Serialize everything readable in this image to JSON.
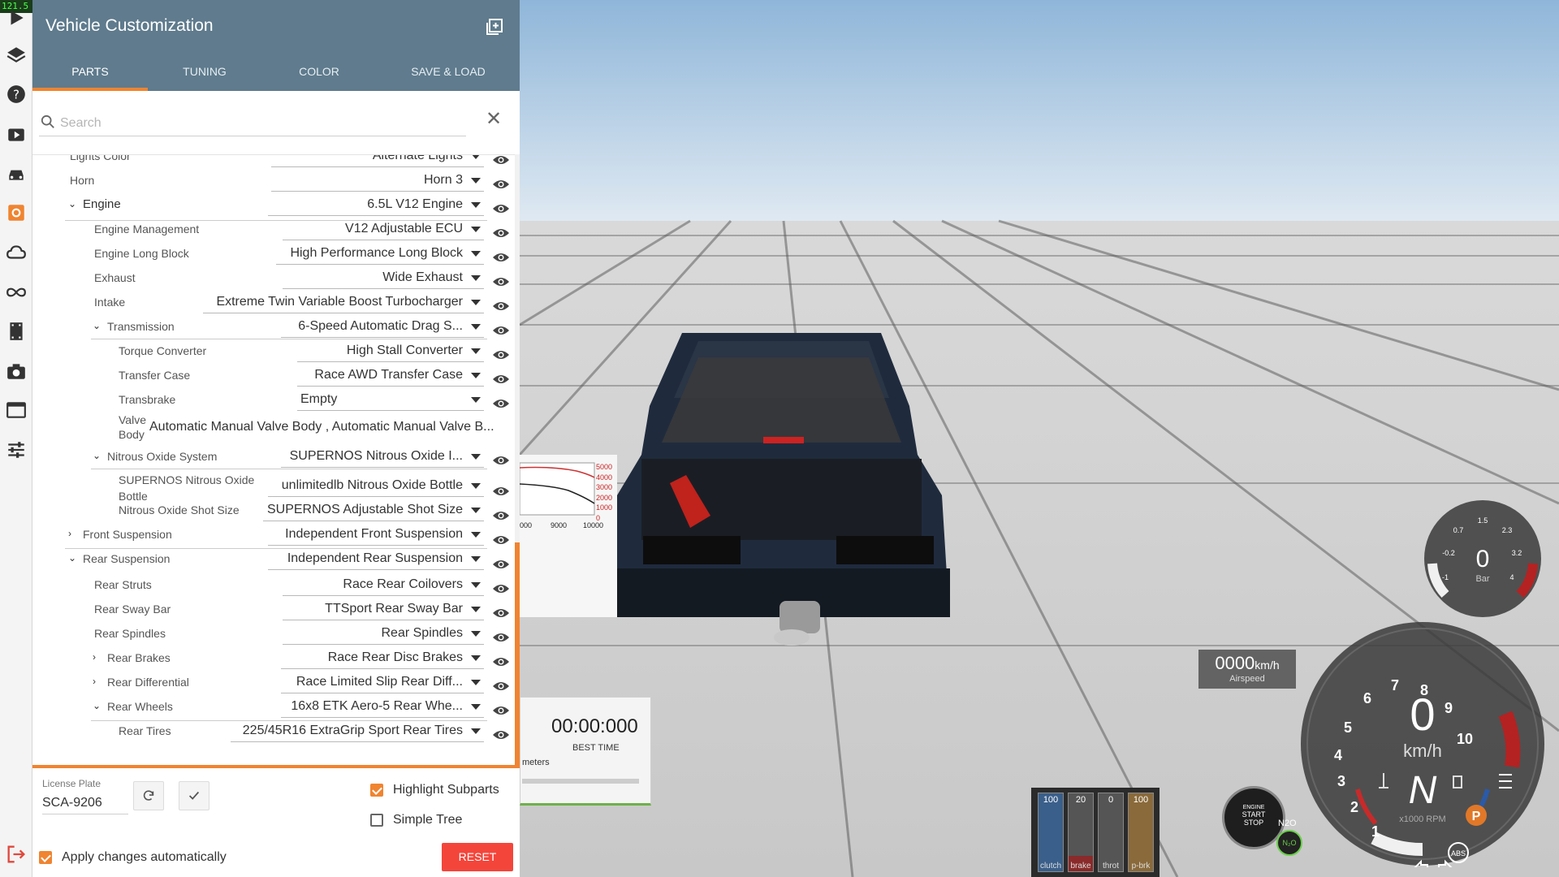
{
  "fps": "121.5",
  "panel": {
    "title": "Vehicle Customization",
    "tabs": [
      "PARTS",
      "TUNING",
      "COLOR",
      "SAVE & LOAD"
    ],
    "active_tab": "PARTS",
    "search_placeholder": "Search"
  },
  "tree": [
    {
      "label": "Lights Color",
      "value": "Alternate Lights"
    },
    {
      "label": "Horn",
      "value": "Horn 3"
    },
    {
      "label": "Engine",
      "value": "6.5L V12 Engine"
    },
    {
      "label": "Engine Management",
      "value": "V12 Adjustable ECU"
    },
    {
      "label": "Engine Long Block",
      "value": "High Performance Long Block"
    },
    {
      "label": "Exhaust",
      "value": "Wide Exhaust"
    },
    {
      "label": "Intake",
      "value": "Extreme Twin Variable Boost Turbocharger"
    },
    {
      "label": "Transmission",
      "value": "6-Speed Automatic Drag S..."
    },
    {
      "label": "Torque Converter",
      "value": "High Stall Converter"
    },
    {
      "label": "Transfer Case",
      "value": "Race AWD Transfer Case"
    },
    {
      "label": "Transbrake",
      "value": "Empty"
    },
    {
      "label_line1": "Valve",
      "label_line2": "Body",
      "value": "Automatic Manual Valve Body , Automatic Manual Valve B..."
    },
    {
      "label": "Nitrous Oxide System",
      "value": "SUPERNOS Nitrous Oxide I..."
    },
    {
      "label_line1": "SUPERNOS Nitrous Oxide",
      "label_line2": "Bottle",
      "value": "unlimitedlb Nitrous Oxide Bottle"
    },
    {
      "label": "Nitrous Oxide Shot Size",
      "value": "SUPERNOS Adjustable Shot Size"
    },
    {
      "label": "Front Suspension",
      "value": "Independent Front Suspension"
    },
    {
      "label": "Rear Suspension",
      "value": "Independent Rear Suspension"
    },
    {
      "label": "Rear Struts",
      "value": "Race Rear Coilovers"
    },
    {
      "label": "Rear Sway Bar",
      "value": "TTSport Rear Sway Bar"
    },
    {
      "label": "Rear Spindles",
      "value": "Rear Spindles"
    },
    {
      "label": "Rear Brakes",
      "value": "Race Rear Disc Brakes"
    },
    {
      "label": "Rear Differential",
      "value": "Race Limited Slip Rear Diff..."
    },
    {
      "label": "Rear Wheels",
      "value": "16x8 ETK Aero-5 Rear Whe..."
    },
    {
      "label": "Rear Tires",
      "value": "225/45R16 ExtraGrip Sport Rear Tires"
    }
  ],
  "footer": {
    "license_label": "License Plate",
    "license_value": "SCA-9206",
    "highlight_label": "Highlight Subparts",
    "highlight_checked": true,
    "simple_tree_label": "Simple Tree",
    "simple_tree_checked": false,
    "apply_label": "Apply changes automatically",
    "apply_checked": true,
    "reset_label": "RESET"
  },
  "graph": {
    "y_ticks": [
      "5000",
      "4000",
      "3000",
      "2000",
      "1000",
      "0"
    ],
    "x_ticks": [
      "000",
      "9000",
      "10000"
    ]
  },
  "timer": {
    "value": "00:00:000",
    "label": "BEST TIME",
    "sub": "meters"
  },
  "airspeed": {
    "value": "0000",
    "unit": "km/h",
    "label": "Airspeed"
  },
  "pedals": [
    {
      "value": "100",
      "label": "clutch",
      "level": 1.0,
      "color": "#3a5f8a"
    },
    {
      "value": "20",
      "label": "brake",
      "level": 0.2,
      "color": "#8a2a2a"
    },
    {
      "value": "0",
      "label": "throt",
      "level": 0.0,
      "color": "#5a5a5a"
    },
    {
      "value": "100",
      "label": "p-brk",
      "level": 1.0,
      "color": "#8a6a3a"
    }
  ],
  "start_button": {
    "line1": "ENGINE",
    "line2": "START",
    "line3": "STOP"
  },
  "nos": {
    "top": "N2O",
    "badge": "N₂O"
  },
  "boost_gauge": {
    "value": "0",
    "unit": "Bar",
    "ticks": [
      "-1",
      "-0.2",
      "0.7",
      "1.5",
      "2.3",
      "3.2",
      "4"
    ]
  },
  "tacho": {
    "speed": "0",
    "unit": "km/h",
    "gear": "N",
    "rpm_label": "x1000 RPM",
    "ticks": [
      "1",
      "2",
      "3",
      "4",
      "5",
      "6",
      "7",
      "8",
      "9",
      "10"
    ],
    "park": "P",
    "abs": "ABS"
  },
  "colors": {
    "accent": "#f08430",
    "header": "#5f7b8d",
    "reset": "#f4453b"
  }
}
